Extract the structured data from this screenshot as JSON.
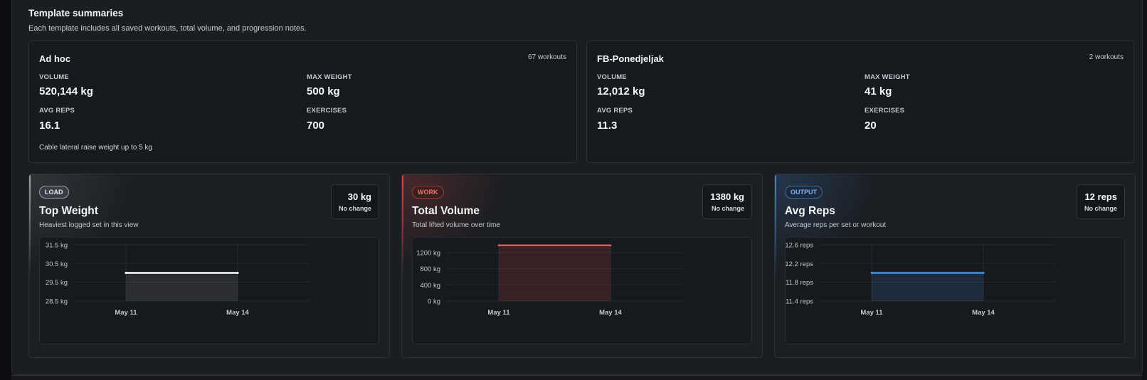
{
  "section": {
    "title": "Template summaries",
    "subtitle": "Each template includes all saved workouts, total volume, and progression notes."
  },
  "templates": [
    {
      "name": "Ad hoc",
      "count": "67 workouts",
      "volume_label": "VOLUME",
      "volume": "520,144 kg",
      "max_weight_label": "MAX WEIGHT",
      "max_weight": "500 kg",
      "avg_reps_label": "AVG REPS",
      "avg_reps": "16.1",
      "exercises_label": "EXERCISES",
      "exercises": "700",
      "note": "Cable lateral raise weight up to 5 kg"
    },
    {
      "name": "FB-Ponedjeljak",
      "count": "2 workouts",
      "volume_label": "VOLUME",
      "volume": "12,012 kg",
      "max_weight_label": "MAX WEIGHT",
      "max_weight": "41 kg",
      "avg_reps_label": "AVG REPS",
      "avg_reps": "11.3",
      "exercises_label": "EXERCISES",
      "exercises": "20",
      "note": ""
    }
  ],
  "metrics": [
    {
      "badge": "LOAD",
      "title": "Top Weight",
      "description": "Heaviest logged set in this view",
      "value": "30 kg",
      "change": "No change",
      "color": "#ffffff"
    },
    {
      "badge": "WORK",
      "title": "Total Volume",
      "description": "Total lifted volume over time",
      "value": "1380 kg",
      "change": "No change",
      "color": "#e5534b"
    },
    {
      "badge": "OUTPUT",
      "title": "Avg Reps",
      "description": "Average reps per set or workout",
      "value": "12 reps",
      "change": "No change",
      "color": "#4a90e2"
    }
  ],
  "chart_data": [
    {
      "type": "area",
      "x": [
        "May 11",
        "May 14"
      ],
      "values": [
        30,
        30
      ],
      "yticks": [
        "28.5 kg",
        "29.5 kg",
        "30.5 kg",
        "31.5 kg"
      ],
      "ylim": [
        28.5,
        31.5
      ],
      "grid": true
    },
    {
      "type": "area",
      "x": [
        "May 11",
        "May 14"
      ],
      "values": [
        1380,
        1380
      ],
      "yticks": [
        "0 kg",
        "400 kg",
        "800 kg",
        "1200 kg"
      ],
      "ylim": [
        0,
        1200
      ],
      "grid": true
    },
    {
      "type": "area",
      "x": [
        "May 11",
        "May 14"
      ],
      "values": [
        12,
        12
      ],
      "yticks": [
        "11.4 reps",
        "11.8 reps",
        "12.2 reps",
        "12.6 reps"
      ],
      "ylim": [
        11.4,
        12.6
      ],
      "grid": true
    }
  ]
}
